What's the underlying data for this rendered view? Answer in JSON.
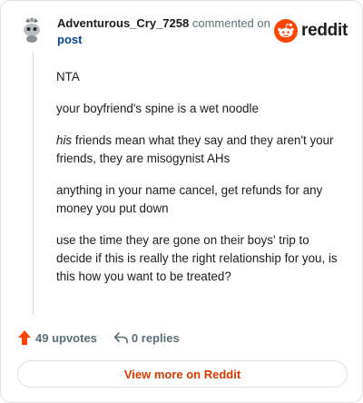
{
  "header": {
    "username": "Adventurous_Cry_7258",
    "commented_text": "commented on",
    "post_link": "post",
    "brand": "reddit"
  },
  "comment": {
    "paragraphs": [
      {
        "text": "NTA"
      },
      {
        "text": "your boyfriend's spine is a wet noodle"
      },
      {
        "italic": "his",
        "text": " friends mean what they say and they aren't your friends, they are misogynist AHs"
      },
      {
        "text": "anything in your name cancel, get refunds for any money you put down"
      },
      {
        "text": "use the time they are gone on their boys' trip to decide if this is really the right relationship for you, is this how you want to be treated?"
      }
    ]
  },
  "actions": {
    "upvotes": "49 upvotes",
    "replies": "0 replies"
  },
  "footer": {
    "view_more": "View more on Reddit"
  },
  "colors": {
    "upvote": "#ff4500",
    "brand": "#ff4500",
    "link": "#0a449b",
    "view_more": "#d93900"
  },
  "icons": [
    "snoo-avatar-icon",
    "reddit-logo-icon",
    "upvote-arrow-icon",
    "reply-arrow-icon"
  ]
}
